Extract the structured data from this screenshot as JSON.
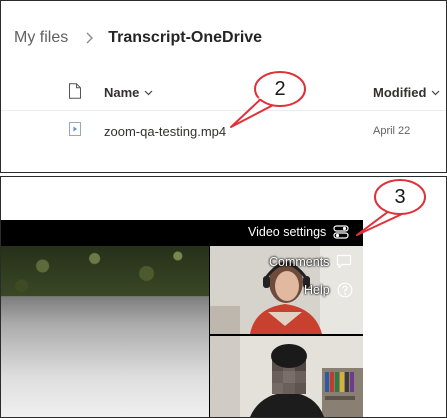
{
  "onedrive": {
    "breadcrumb": {
      "root": "My files",
      "current": "Transcript-OneDrive"
    },
    "columns": {
      "name": "Name",
      "modified": "Modified"
    },
    "file": {
      "name": "zoom-qa-testing.mp4",
      "modified": "April 22"
    }
  },
  "callouts": {
    "step2": "2",
    "step3": "3"
  },
  "player": {
    "menu": {
      "video_settings": "Video settings",
      "comments": "Comments",
      "help": "Help"
    }
  },
  "colors": {
    "callout_stroke": "#e0303a",
    "chrome_text": "#ffffff",
    "video_bar": "#000000"
  },
  "icons": {
    "breadcrumb_separator": "chevron-right-icon",
    "file_type_header": "document-icon",
    "file": "video-file-icon",
    "sort": "chevron-down-icon",
    "video_settings": "settings-toggle-icon",
    "comments": "comment-icon",
    "help": "help-circle-icon"
  }
}
